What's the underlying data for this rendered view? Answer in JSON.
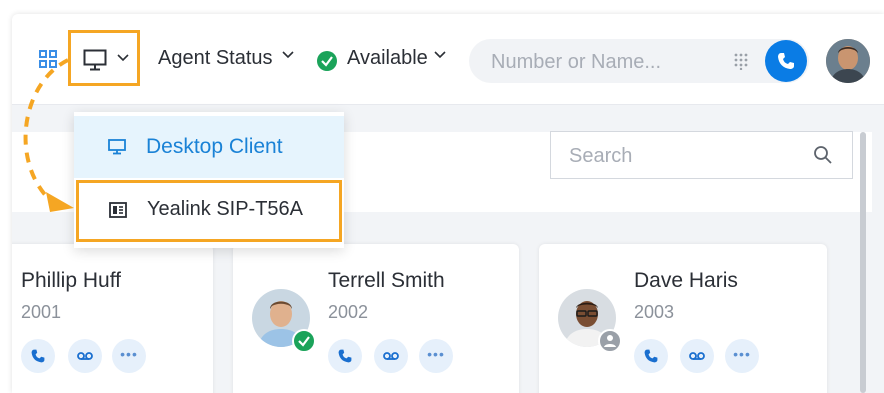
{
  "topbar": {
    "agent_status_label": "Agent Status",
    "availability_label": "Available",
    "search_placeholder": "Number or Name..."
  },
  "device_menu": {
    "items": [
      {
        "label": "Desktop Client",
        "icon": "monitor-icon",
        "selected": true
      },
      {
        "label": "Yealink SIP-T56A",
        "icon": "desk-phone-icon",
        "selected": false
      }
    ]
  },
  "panel": {
    "search_placeholder": "Search"
  },
  "contacts": [
    {
      "name": "Phillip Huff",
      "ext": "2001"
    },
    {
      "name": "Terrell Smith",
      "ext": "2002",
      "status": "available"
    },
    {
      "name": "Dave Haris",
      "ext": "2003",
      "status": "offline"
    }
  ],
  "colors": {
    "accent": "#0a7ce5",
    "highlight": "#f5a623",
    "available": "#1ba35a",
    "offline": "#9aa0a8"
  }
}
